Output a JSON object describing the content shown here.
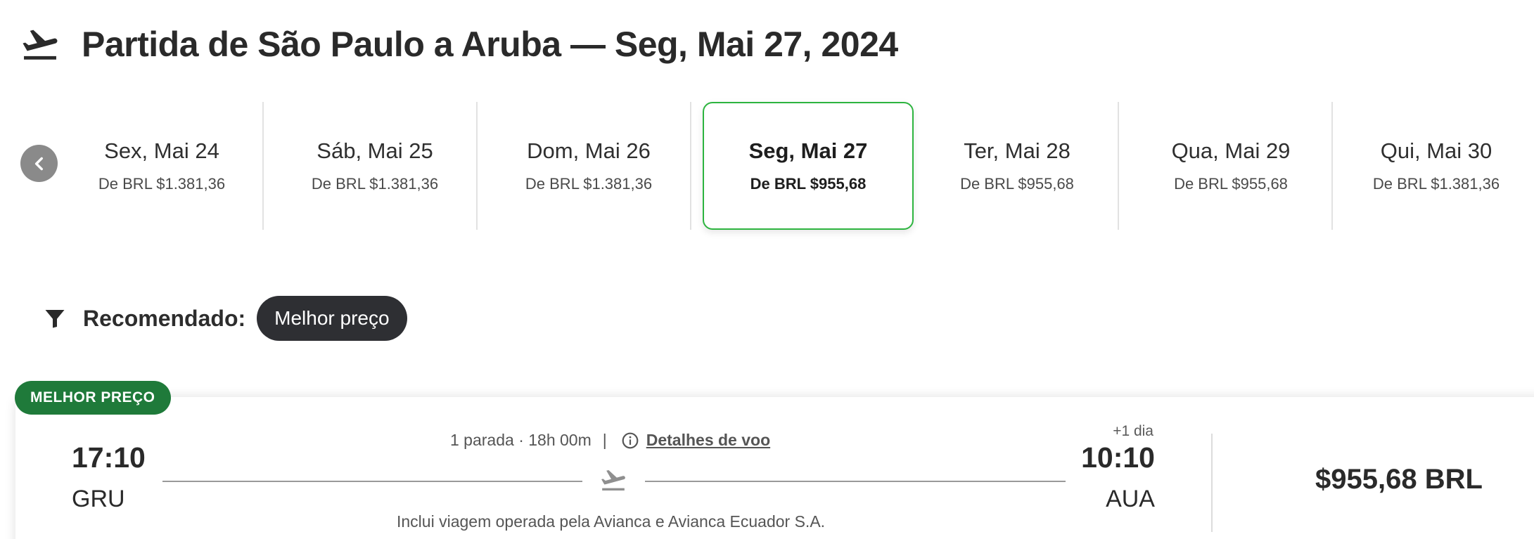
{
  "header": {
    "title": "Partida de São Paulo a Aruba — Seg, Mai 27, 2024",
    "icon": "airplane-takeoff-icon"
  },
  "date_strip": {
    "prev_icon": "chevron-left-icon",
    "items": [
      {
        "label": "Sex, Mai 24",
        "price": "De BRL $1.381,36",
        "selected": false
      },
      {
        "label": "Sáb, Mai 25",
        "price": "De BRL $1.381,36",
        "selected": false
      },
      {
        "label": "Dom, Mai 26",
        "price": "De BRL $1.381,36",
        "selected": false
      },
      {
        "label": "Seg, Mai 27",
        "price": "De BRL $955,68",
        "selected": true
      },
      {
        "label": "Ter, Mai 28",
        "price": "De BRL $955,68",
        "selected": false
      },
      {
        "label": "Qua, Mai 29",
        "price": "De BRL $955,68",
        "selected": false
      },
      {
        "label": "Qui, Mai 30",
        "price": "De BRL $1.381,36",
        "selected": false
      }
    ]
  },
  "sort": {
    "icon": "filter-icon",
    "label": "Recomendado:",
    "chip": "Melhor preço"
  },
  "flight": {
    "badge": "MELHOR PREÇO",
    "departure_time": "17:10",
    "departure_code": "GRU",
    "arrival_time": "10:10",
    "arrival_code": "AUA",
    "plus_day": "+1 dia",
    "stops_duration": "1 parada · 18h 00m",
    "separator": "|",
    "details_link": "Detalhes de voo",
    "operated_by": "Inclui viagem operada pela Avianca e Avianca Ecuador S.A.",
    "price": "$955,68 BRL"
  },
  "colors": {
    "selected_border": "#2db43f",
    "badge_bg": "#1f7a3a",
    "chip_bg": "#2e2f33"
  }
}
